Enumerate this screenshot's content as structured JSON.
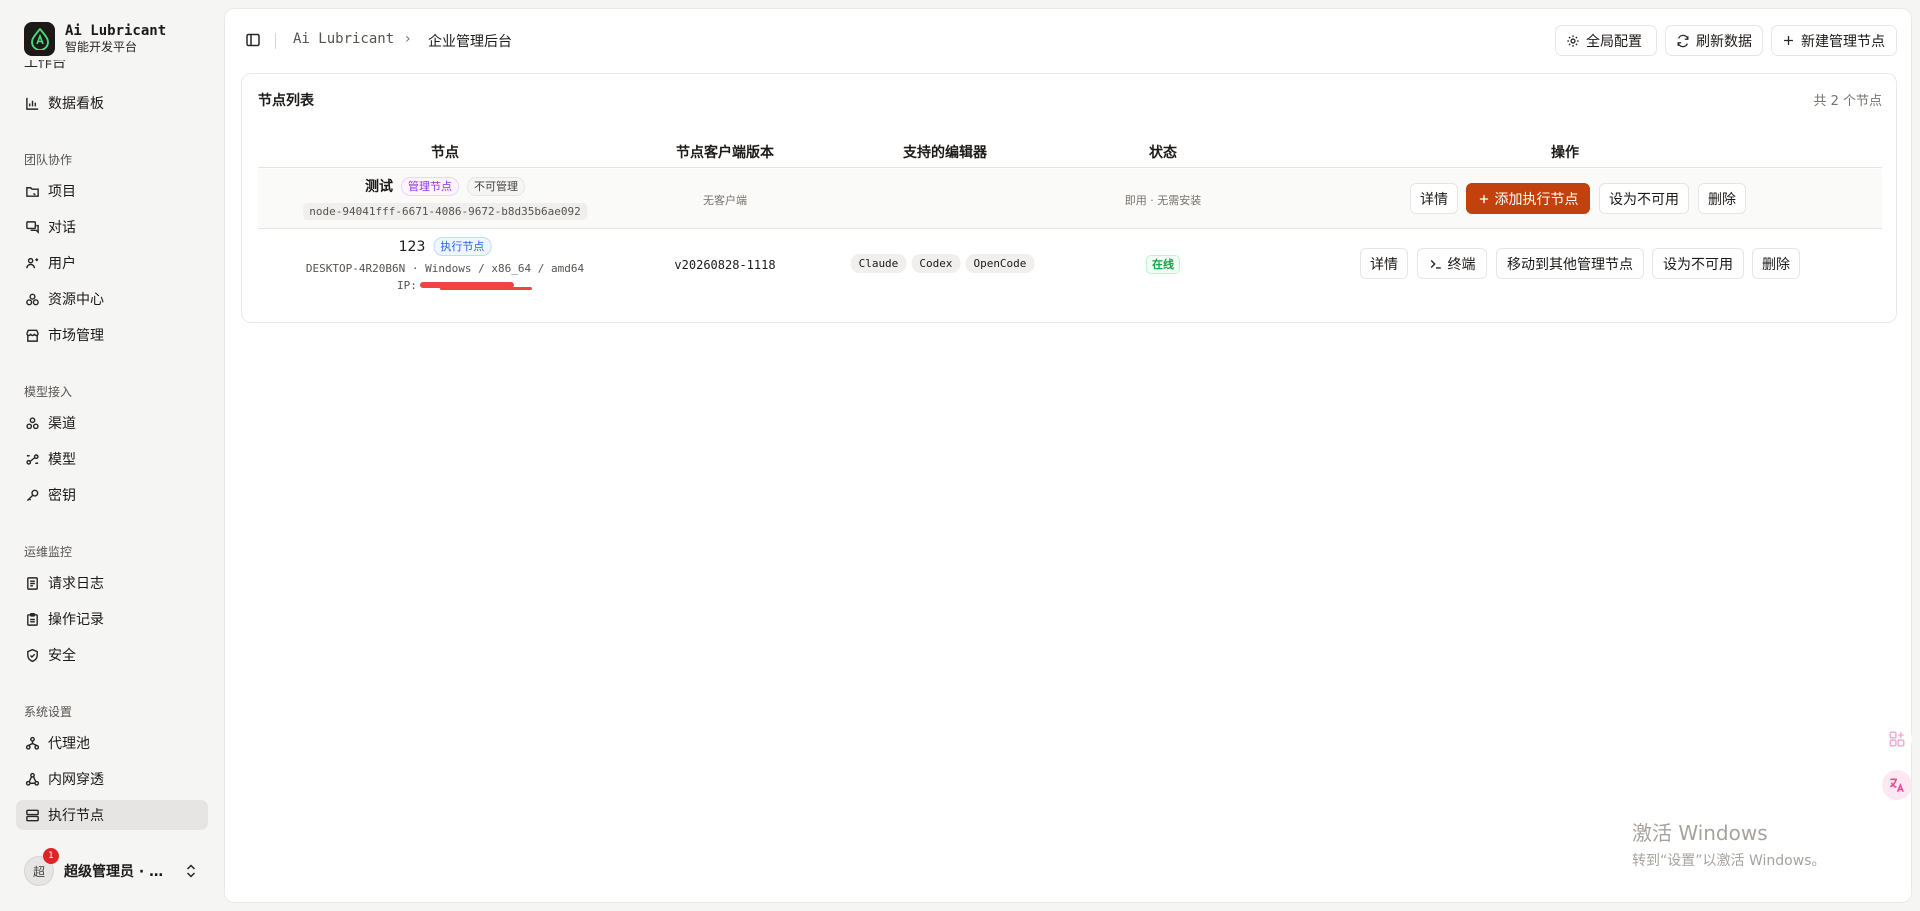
{
  "brand": {
    "title": "Ai Lubricant",
    "subtitle": "智能开发平台"
  },
  "sidebar": {
    "cut_item": "工作台",
    "items_top": [
      {
        "label": "数据看板",
        "icon": "bar-chart-icon"
      }
    ],
    "sections": [
      {
        "label": "团队协作",
        "items": [
          {
            "label": "项目",
            "icon": "folder-icon"
          },
          {
            "label": "对话",
            "icon": "chat-icon"
          },
          {
            "label": "用户",
            "icon": "users-icon"
          },
          {
            "label": "资源中心",
            "icon": "resources-icon"
          },
          {
            "label": "市场管理",
            "icon": "store-icon"
          }
        ]
      },
      {
        "label": "模型接入",
        "items": [
          {
            "label": "渠道",
            "icon": "channel-icon"
          },
          {
            "label": "模型",
            "icon": "model-icon"
          },
          {
            "label": "密钥",
            "icon": "key-icon"
          }
        ]
      },
      {
        "label": "运维监控",
        "items": [
          {
            "label": "请求日志",
            "icon": "log-icon"
          },
          {
            "label": "操作记录",
            "icon": "clipboard-icon"
          },
          {
            "label": "安全",
            "icon": "shield-icon"
          }
        ]
      },
      {
        "label": "系统设置",
        "items": [
          {
            "label": "代理池",
            "icon": "network-icon"
          },
          {
            "label": "内网穿透",
            "icon": "tunnel-icon"
          },
          {
            "label": "执行节点",
            "icon": "server-icon"
          }
        ]
      }
    ],
    "active": "执行节点"
  },
  "user": {
    "avatar": "超",
    "badge": "1",
    "name": "超级管理员 · …"
  },
  "breadcrumb": {
    "root": "Ai Lubricant",
    "sep": "›",
    "current": "企业管理后台"
  },
  "toolbar": {
    "config": "全局配置",
    "refresh": "刷新数据",
    "new_manager": "新建管理节点"
  },
  "card": {
    "title": "节点列表",
    "count": "共 2 个节点"
  },
  "table": {
    "headers": [
      "节点",
      "节点客户端版本",
      "支持的编辑器",
      "状态",
      "操作"
    ],
    "rows": [
      {
        "name": "测试",
        "tags": [
          "管理节点",
          "不可管理"
        ],
        "sub": "node-94041fff-6671-4086-9672-b8d35b6ae092",
        "version": "无客户端",
        "editors": [],
        "status": "即用 · 无需安装",
        "actions": [
          "详情",
          "添加执行节点",
          "设为不可用",
          "删除"
        ]
      },
      {
        "name": "123",
        "tags": [
          "执行节点"
        ],
        "sub": "DESKTOP-4R20B6N · Windows / x86_64 / amd64",
        "ip_label": "IP:",
        "version": "v20260828-1118",
        "editors": [
          "Claude",
          "Codex",
          "OpenCode"
        ],
        "status": "在线",
        "actions": [
          "详情",
          "终端",
          "移动到其他管理节点",
          "设为不可用",
          "删除"
        ]
      }
    ]
  },
  "watermark": {
    "line1": "激活 Windows",
    "line2": "转到“设置”以激活 Windows。"
  },
  "colors": {
    "primary": "#c2410c",
    "active_bg": "#e7e5e4",
    "online": "#16a34a",
    "manager_tag": "#9333ea",
    "exec_tag": "#2563eb"
  }
}
